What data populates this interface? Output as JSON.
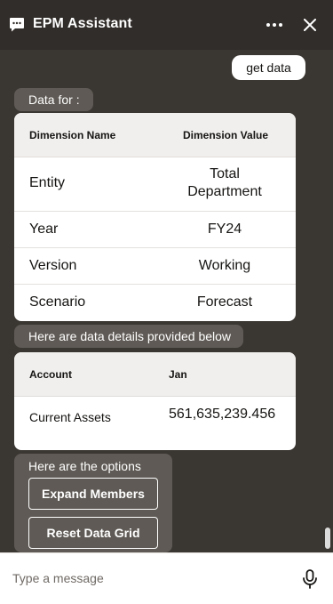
{
  "header": {
    "title": "EPM Assistant",
    "icons": {
      "logo": "chat-bubble-icon",
      "more": "more-horizontal-icon",
      "close": "close-icon"
    }
  },
  "messages": {
    "user_message": "get data",
    "data_for_label": "Data for :",
    "dimension_table": {
      "headers": [
        "Dimension Name",
        "Dimension Value"
      ],
      "rows": [
        {
          "name": "Entity",
          "value": "Total Department"
        },
        {
          "name": "Year",
          "value": "FY24"
        },
        {
          "name": "Version",
          "value": "Working"
        },
        {
          "name": "Scenario",
          "value": "Forecast"
        }
      ]
    },
    "details_label": "Here are data details provided below",
    "account_table": {
      "headers": [
        "Account",
        "Jan"
      ],
      "rows": [
        {
          "account": "Current Assets",
          "jan": "561,635,239.456"
        }
      ]
    },
    "options": {
      "label": "Here are the options",
      "buttons": [
        "Expand Members",
        "Reset Data Grid"
      ]
    }
  },
  "footer": {
    "placeholder": "Type a message",
    "icons": {
      "mic": "microphone-icon"
    }
  },
  "colors": {
    "header_bg": "#312d2a",
    "conversation_bg": "#3a3631",
    "chip_bg": "#5f5a55",
    "card_bg": "#ffffff"
  }
}
